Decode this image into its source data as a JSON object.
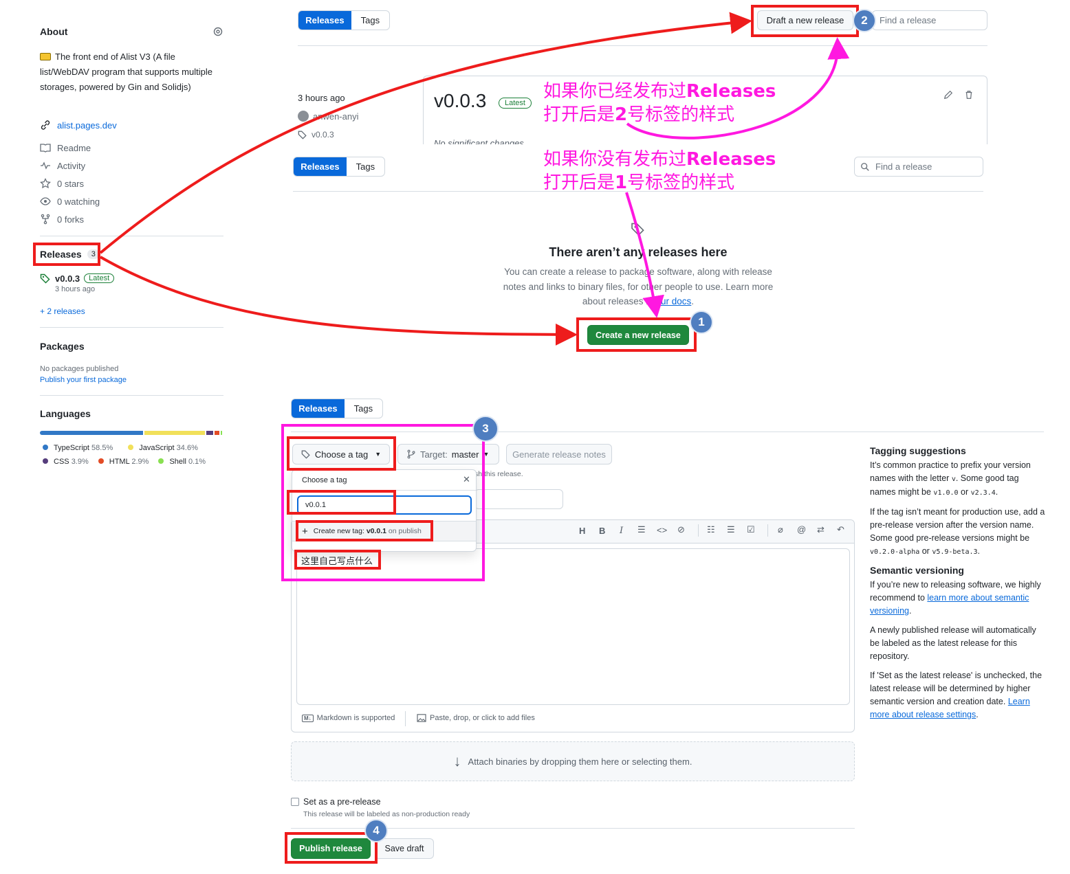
{
  "sidebar": {
    "about_title": "About",
    "description": "The front end of Alist V3 (A file list/WebDAV program that supports multiple storages, powered by Gin and Solidjs)",
    "website": "alist.pages.dev",
    "readme": "Readme",
    "activity": "Activity",
    "stars": "0 stars",
    "watching": "0 watching",
    "forks": "0 forks",
    "releases_label": "Releases",
    "releases_count": "3",
    "latest_version": "v0.0.3",
    "latest_badge": "Latest",
    "latest_time": "3 hours ago",
    "more_releases": "+ 2 releases",
    "packages_title": "Packages",
    "packages_empty": "No packages published",
    "packages_link": "Publish your first package",
    "languages_title": "Languages",
    "languages": [
      {
        "name": "TypeScript",
        "pct": "58.5%",
        "color": "#3178c6",
        "value": 58.5
      },
      {
        "name": "JavaScript",
        "pct": "34.6%",
        "color": "#f1e05a",
        "value": 34.6
      },
      {
        "name": "CSS",
        "pct": "3.9%",
        "color": "#563d7c",
        "value": 3.9
      },
      {
        "name": "HTML",
        "pct": "2.9%",
        "color": "#e34c26",
        "value": 2.9
      },
      {
        "name": "Shell",
        "pct": "0.1%",
        "color": "#89e051",
        "value": 0.1
      }
    ]
  },
  "tabs": {
    "releases": "Releases",
    "tags": "Tags"
  },
  "panel1": {
    "draft_btn": "Draft a new release",
    "find_placeholder": "Find a release",
    "time": "3 hours ago",
    "author": "anwen-anyi",
    "tag": "v0.0.3",
    "version": "v0.0.3",
    "latest": "Latest",
    "notes": "No significant changes"
  },
  "panel2": {
    "find_placeholder": "Find a release",
    "empty_title": "There aren’t any releases here",
    "empty_desc_1": "You can create a release to package software, along with release",
    "empty_desc_2": "notes and links to binary files, for other people to use. Learn more",
    "empty_desc_3": "about releases in",
    "docs_link": "our docs",
    "create_btn": "Create a new release"
  },
  "annotations": {
    "a1_line1_pre": "如果你已经发布过",
    "a1_line1_bold": "Releases",
    "a1_line2_pre": "打开后是",
    "a1_line2_bold": "2",
    "a1_line2_post": "号标签的样式",
    "a2_line1_pre": "如果你没有发布过",
    "a2_line1_bold": "Releases",
    "a2_line2_pre": "打开后是",
    "a2_line2_bold": "1",
    "a2_line2_post": "号标签的样式",
    "n1": "1",
    "n2": "2",
    "n3": "3",
    "n4": "4"
  },
  "panel3": {
    "choose_tag": "Choose a tag",
    "target_label": "Target:",
    "target_value": "master",
    "generate_notes": "Generate release notes",
    "hint_fragment": "sh this release.",
    "dropdown_title": "Choose a tag",
    "tag_input": "v0.0.1",
    "create_tag_pre": "Create new tag: ",
    "create_tag_bold": "v0.0.1",
    "create_tag_post": " on publish",
    "body_text": "这里自己写点什么",
    "markdown": "Markdown is supported",
    "paste": "Paste, drop, or click to add files",
    "attach": "Attach binaries by dropping them here or selecting them.",
    "prerelease": "Set as a pre-release",
    "prerelease_hint": "This release will be labeled as non-production ready",
    "publish": "Publish release",
    "save_draft": "Save draft",
    "toolbar": [
      "H",
      "B",
      "I"
    ]
  },
  "right_panel": {
    "h1": "Tagging suggestions",
    "p1a": "It’s common practice to prefix your version names with the letter ",
    "p1code1": "v",
    "p1b": ". Some good tag names might be ",
    "p1code2": "v1.0.0",
    "p1c": " or ",
    "p1code3": "v2.3.4",
    "p1d": ".",
    "p2a": "If the tag isn’t meant for production use, add a pre-release version after the version name. Some good pre-release versions might be ",
    "p2code1": "v0.2.0-alpha",
    "p2b": " or ",
    "p2code2": "v5.9-beta.3",
    "p2c": ".",
    "h2": "Semantic versioning",
    "p3a": "If you’re new to releasing software, we highly recommend to ",
    "p3link": "learn more about semantic versioning",
    "p3b": ".",
    "p4": "A newly published release will automatically be labeled as the latest release for this repository.",
    "p5a": "If 'Set as the latest release' is unchecked, the latest release will be determined by higher semantic version and creation date. ",
    "p5link": "Learn more about release settings",
    "p5b": "."
  }
}
